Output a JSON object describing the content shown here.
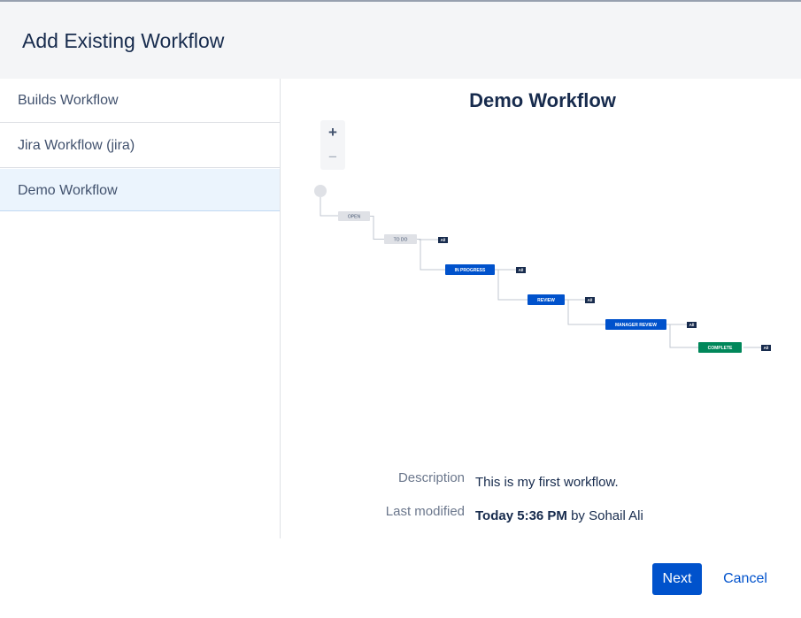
{
  "dialog": {
    "title": "Add Existing Workflow"
  },
  "sidebar": {
    "items": [
      {
        "label": "Builds Workflow",
        "selected": false
      },
      {
        "label": "Jira Workflow (jira)",
        "selected": false
      },
      {
        "label": "Demo Workflow",
        "selected": true
      }
    ]
  },
  "preview": {
    "title": "Demo Workflow",
    "zoom_in": "+",
    "zoom_out": "−",
    "statuses": [
      {
        "label": "OPEN",
        "category": "todo"
      },
      {
        "label": "TO DO",
        "category": "todo"
      },
      {
        "label": "IN PROGRESS",
        "category": "in-progress"
      },
      {
        "label": "REVIEW",
        "category": "in-progress"
      },
      {
        "label": "MANAGER REVIEW",
        "category": "in-progress"
      },
      {
        "label": "COMPLETE",
        "category": "done"
      }
    ],
    "all_badge": "All",
    "colors": {
      "todo": "#dfe1e6",
      "in_progress": "#0052cc",
      "done": "#00875a",
      "badge": "#172b4d",
      "connector": "#c1c7d0"
    },
    "description_label": "Description",
    "description_value": "This is my first workflow.",
    "modified_label": "Last modified",
    "modified_time": "Today 5:36 PM",
    "modified_by": "by Sohail Ali"
  },
  "footer": {
    "next_label": "Next",
    "cancel_label": "Cancel"
  }
}
